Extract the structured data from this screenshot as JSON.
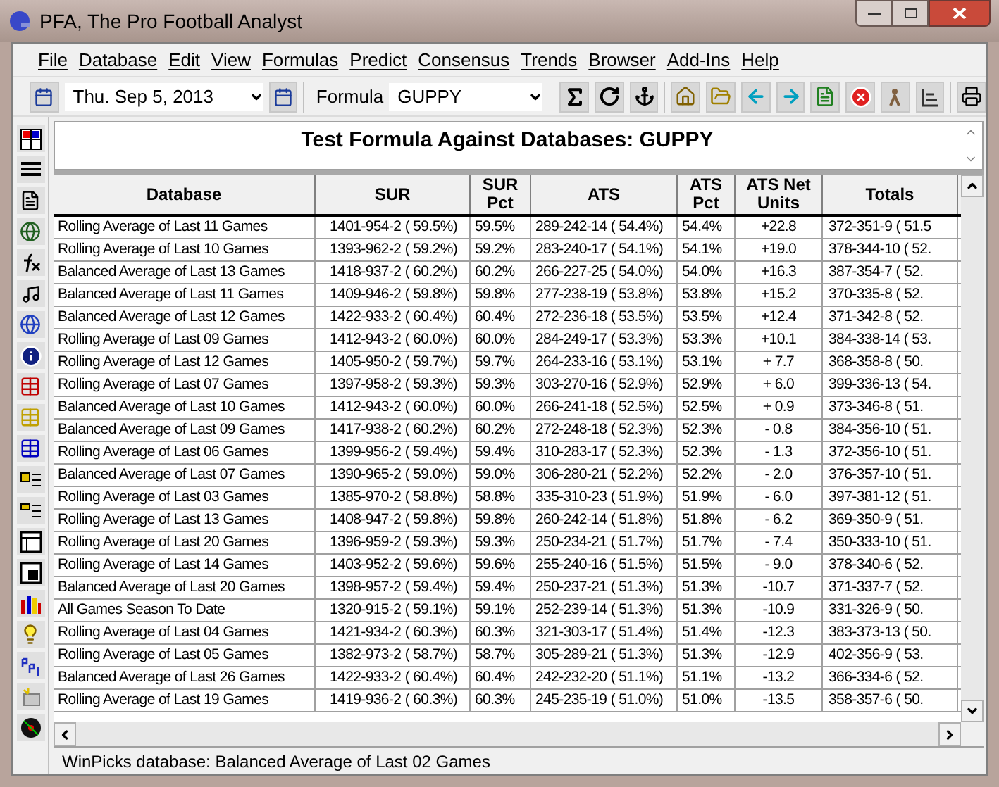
{
  "window": {
    "title": "PFA,  The Pro Football Analyst"
  },
  "menu": [
    "File",
    "Database",
    "Edit",
    "View",
    "Formulas",
    "Predict",
    "Consensus",
    "Trends",
    "Browser",
    "Add-Ins",
    "Help"
  ],
  "toolbar": {
    "date": "Thu. Sep  5, 2013",
    "formula_label": "Formula",
    "formula": "GUPPY"
  },
  "heading": "Test Formula Against Databases: GUPPY",
  "table": {
    "columns": [
      "Database",
      "SUR",
      "SUR Pct",
      "ATS",
      "ATS Pct",
      "ATS Net Units",
      "Totals"
    ],
    "rows": [
      [
        "Rolling Average of Last 11 Games",
        "1401-954-2 (  59.5%)",
        "59.5%",
        "289-242-14 (  54.4%)",
        "54.4%",
        "+22.8",
        "372-351-9 (  51.5"
      ],
      [
        "Rolling Average of Last 10 Games",
        "1393-962-2 (  59.2%)",
        "59.2%",
        "283-240-17 (  54.1%)",
        "54.1%",
        "+19.0",
        "378-344-10 (  52."
      ],
      [
        "Balanced Average of Last 13 Games",
        "1418-937-2 (  60.2%)",
        "60.2%",
        "266-227-25 (  54.0%)",
        "54.0%",
        "+16.3",
        "387-354-7 (  52."
      ],
      [
        "Balanced Average of Last 11 Games",
        "1409-946-2 (  59.8%)",
        "59.8%",
        "277-238-19 (  53.8%)",
        "53.8%",
        "+15.2",
        "370-335-8 (  52."
      ],
      [
        "Balanced Average of Last 12 Games",
        "1422-933-2 (  60.4%)",
        "60.4%",
        "272-236-18 (  53.5%)",
        "53.5%",
        "+12.4",
        "371-342-8 (  52."
      ],
      [
        "Rolling Average of Last 09 Games",
        "1412-943-2 (  60.0%)",
        "60.0%",
        "284-249-17 (  53.3%)",
        "53.3%",
        "+10.1",
        "384-338-14 (  53."
      ],
      [
        "Rolling Average of Last 12 Games",
        "1405-950-2 (  59.7%)",
        "59.7%",
        "264-233-16 (  53.1%)",
        "53.1%",
        "+ 7.7",
        "368-358-8 (  50."
      ],
      [
        "Rolling Average of Last 07 Games",
        "1397-958-2 (  59.3%)",
        "59.3%",
        "303-270-16 (  52.9%)",
        "52.9%",
        "+ 6.0",
        "399-336-13 (  54."
      ],
      [
        "Balanced Average of Last 10 Games",
        "1412-943-2 (  60.0%)",
        "60.0%",
        "266-241-18 (  52.5%)",
        "52.5%",
        "+ 0.9",
        "373-346-8 (  51."
      ],
      [
        "Balanced Average of Last 09 Games",
        "1417-938-2 (  60.2%)",
        "60.2%",
        "272-248-18 (  52.3%)",
        "52.3%",
        "- 0.8",
        "384-356-10 (  51."
      ],
      [
        "Rolling Average of Last 06 Games",
        "1399-956-2 (  59.4%)",
        "59.4%",
        "310-283-17 (  52.3%)",
        "52.3%",
        "- 1.3",
        "372-356-10 (  51."
      ],
      [
        "Balanced Average of Last 07 Games",
        "1390-965-2 (  59.0%)",
        "59.0%",
        "306-280-21 (  52.2%)",
        "52.2%",
        "- 2.0",
        "376-357-10 (  51."
      ],
      [
        "Rolling Average of Last 03 Games",
        "1385-970-2 (  58.8%)",
        "58.8%",
        "335-310-23 (  51.9%)",
        "51.9%",
        "- 6.0",
        "397-381-12 (  51."
      ],
      [
        "Rolling Average of Last 13 Games",
        "1408-947-2 (  59.8%)",
        "59.8%",
        "260-242-14 (  51.8%)",
        "51.8%",
        "- 6.2",
        "369-350-9 (  51."
      ],
      [
        "Rolling Average of Last 20 Games",
        "1396-959-2 (  59.3%)",
        "59.3%",
        "250-234-21 (  51.7%)",
        "51.7%",
        "- 7.4",
        "350-333-10 (  51."
      ],
      [
        "Rolling Average of Last 14 Games",
        "1403-952-2 (  59.6%)",
        "59.6%",
        "255-240-16 (  51.5%)",
        "51.5%",
        "- 9.0",
        "378-340-6 (  52."
      ],
      [
        "Balanced Average of Last 20 Games",
        "1398-957-2 (  59.4%)",
        "59.4%",
        "250-237-21 (  51.3%)",
        "51.3%",
        "-10.7",
        "371-337-7 (  52."
      ],
      [
        "All Games Season To Date",
        "1320-915-2 (  59.1%)",
        "59.1%",
        "252-239-14 (  51.3%)",
        "51.3%",
        "-10.9",
        "331-326-9 (  50."
      ],
      [
        "Rolling Average of Last 04 Games",
        "1421-934-2 (  60.3%)",
        "60.3%",
        "321-303-17 (  51.4%)",
        "51.4%",
        "-12.3",
        "383-373-13 (  50."
      ],
      [
        "Rolling Average of Last 05 Games",
        "1382-973-2 (  58.7%)",
        "58.7%",
        "305-289-21 (  51.3%)",
        "51.3%",
        "-12.9",
        "402-356-9 (  53."
      ],
      [
        "Balanced Average of Last 26 Games",
        "1422-933-2 (  60.4%)",
        "60.4%",
        "242-232-20 (  51.1%)",
        "51.1%",
        "-13.2",
        "366-334-6 (  52."
      ],
      [
        "Rolling Average of Last 19 Games",
        "1419-936-2 (  60.3%)",
        "60.3%",
        "245-235-19 (  51.0%)",
        "51.0%",
        "-13.5",
        "358-357-6 (  50."
      ]
    ]
  },
  "status_bar": "WinPicks database:  Balanced Average of Last 02 Games"
}
